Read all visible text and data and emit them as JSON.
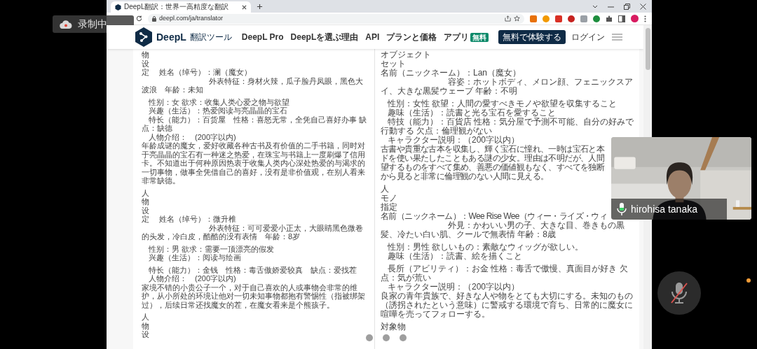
{
  "recording_badge": {
    "label": "录制中"
  },
  "browser": {
    "tab": {
      "title": "DeepL翻訳：世界一高精度な翻訳",
      "selected": true
    },
    "address": "deepl.com/ja/translator"
  },
  "site_header": {
    "brand": "DeepL",
    "product": "翻訳ツール",
    "nav": [
      {
        "label": "DeepL Pro"
      },
      {
        "label": "DeepLを選ぶ理由"
      },
      {
        "label": "API"
      },
      {
        "label": "プランと価格"
      },
      {
        "label": "アプリ",
        "badge": "無料"
      }
    ],
    "cta": "無料で体験する",
    "login": "ログイン"
  },
  "source_panel": {
    "blocks": [
      {
        "lines": [
          {
            "kind": "plain",
            "text": "物"
          },
          {
            "kind": "plain",
            "text": "设"
          },
          {
            "kind": "heading",
            "marker": "定",
            "text": "姓名（绰号）：澜（魔女）"
          },
          {
            "kind": "detail",
            "text": "外表特征：身材火辣，瓜子脸丹凤眼，黑色大波浪　年龄：未知"
          }
        ]
      },
      {
        "lines": [
          {
            "kind": "field",
            "text": "性别：女 欲求：收集人类心爱之物与欲望"
          },
          {
            "kind": "field",
            "text": "兴趣（生活）：热爱阅读与亮晶晶的宝石"
          },
          {
            "kind": "field",
            "text": "特长（能力）：百货屋　性格：喜怒无常，全凭自己喜好办事 缺点：缺德"
          },
          {
            "kind": "field",
            "text": "人物介绍：　(200字以内)"
          },
          {
            "kind": "plain",
            "text": "年龄成谜的魔女，爱好收藏各种古书及有价值的二手书籍，同时对于亮晶晶的宝石有一种迷之热爱，在珠宝与书籍上一度刷爆了信用卡。不知道出于何种原因热衷于收集人类内心深处热爱的与渴求的一切事物，做事全凭借自己的喜好，没有是非价值观，在别人看来非常缺德。"
          }
        ]
      },
      {
        "lines": [
          {
            "kind": "plain",
            "text": "人"
          },
          {
            "kind": "plain",
            "text": "物"
          },
          {
            "kind": "plain",
            "text": "设"
          },
          {
            "kind": "heading",
            "marker": "定",
            "text": "姓名（绰号）：微升椎"
          },
          {
            "kind": "detail",
            "text": "外表特征：可可爱爱小正太，大眼睛黑色微卷的头发，冷白皮，酷酷的没有表情　年龄：8岁"
          }
        ]
      },
      {
        "lines": [
          {
            "kind": "field",
            "text": "性别：男 欲求：需要一顶漂亮的假发"
          },
          {
            "kind": "field",
            "text": "兴趣（生活）：阅读与绘画"
          }
        ]
      },
      {
        "lines": [
          {
            "kind": "field",
            "text": "特长（能力）：金钱　性格：毒舌傲娇爱较真　缺点：爱找茬"
          },
          {
            "kind": "field",
            "text": "人物介绍：　(200字以内)"
          },
          {
            "kind": "plain",
            "text": "家境不错的小贵公子一个，对于自己喜欢的人或事物会非常的维护，从小所处的环境让他对一切未知事物都抱有警惕性（指被绑架过），后续日常还找魔女的茬，在魔女看来是个熊孩子。"
          }
        ]
      },
      {
        "lines": [
          {
            "kind": "plain",
            "text": "人"
          },
          {
            "kind": "plain",
            "text": "物"
          },
          {
            "kind": "plain",
            "text": "设"
          }
        ]
      }
    ]
  },
  "target_panel": {
    "blocks": [
      {
        "lines": [
          {
            "kind": "plain",
            "text": "オブジェクト"
          },
          {
            "kind": "plain",
            "text": "セット"
          },
          {
            "kind": "plain",
            "text": "名前（ニックネーム）：Lan（魔女）"
          },
          {
            "kind": "detail",
            "text": "容姿：ホットボディ、メロン顔、フェニックスアイ、大きな黒髪ウェーブ 年齢：不明"
          }
        ]
      },
      {
        "lines": [
          {
            "kind": "field",
            "text": "性別：女性 欲望：人間の愛すべきモノや欲望を収集すること"
          },
          {
            "kind": "field",
            "text": "趣味（生活）：読書と光る宝石を愛すること"
          },
          {
            "kind": "field",
            "text": "特技（能力）：百貨店 性格：気分屋で予測不可能、自分の好みで行動する 欠点：倫理観がない"
          },
          {
            "kind": "field",
            "text": "キャラクター説明：（200字以内）"
          },
          {
            "kind": "line",
            "text": "古書や貴重な古本を収集し、輝く宝石に憧れ、一時は宝石と本"
          },
          {
            "kind": "line",
            "text": "ドを使い果たしたこともある謎の少女。理由は不明だが、人間"
          },
          {
            "kind": "line",
            "text": "望するものをすべて集め、善悪の価値観もなく、すべてを独断"
          },
          {
            "kind": "line",
            "text": "から見ると非常に倫理観のない人間に見える。"
          }
        ]
      },
      {
        "lines": [
          {
            "kind": "plain",
            "text": "人"
          },
          {
            "kind": "plain",
            "text": "モノ"
          },
          {
            "kind": "plain",
            "text": "指定"
          },
          {
            "kind": "line",
            "text": "名前（ニックネーム）：Wee Rise Wee（ウィー・ライズ・ウィ"
          },
          {
            "kind": "detail",
            "text": "外見：かわいい男の子、大きな目、巻きもの黒髪、冷たい白い肌、クールで無表情 年齢：8歳"
          }
        ]
      },
      {
        "lines": [
          {
            "kind": "field",
            "text": "性別：男性 欲しいもの：素敵なウィッグが欲しい。"
          },
          {
            "kind": "field",
            "text": "趣味（生活）：読書、絵を描くこと"
          }
        ]
      },
      {
        "lines": [
          {
            "kind": "field",
            "text": "長所（アビリティ）：お金 性格：毒舌で傲慢、真面目が好き 欠点：気が荒い"
          },
          {
            "kind": "field",
            "text": "キャラクター説明：（200字以内）"
          },
          {
            "kind": "plain",
            "text": "良家の青年貴族で、好きな人や物をとても大切にする。未知のもの（誘拐されたという意味）に警戒する環境で育ち、日常的に魔女に喧嘩を売ってフォローする。"
          }
        ]
      },
      {
        "lines": [
          {
            "kind": "plain",
            "text": "対象物"
          }
        ]
      }
    ]
  },
  "video_tile": {
    "participant": "hirohisa tanaka"
  },
  "mute_button": {
    "muted": true
  }
}
